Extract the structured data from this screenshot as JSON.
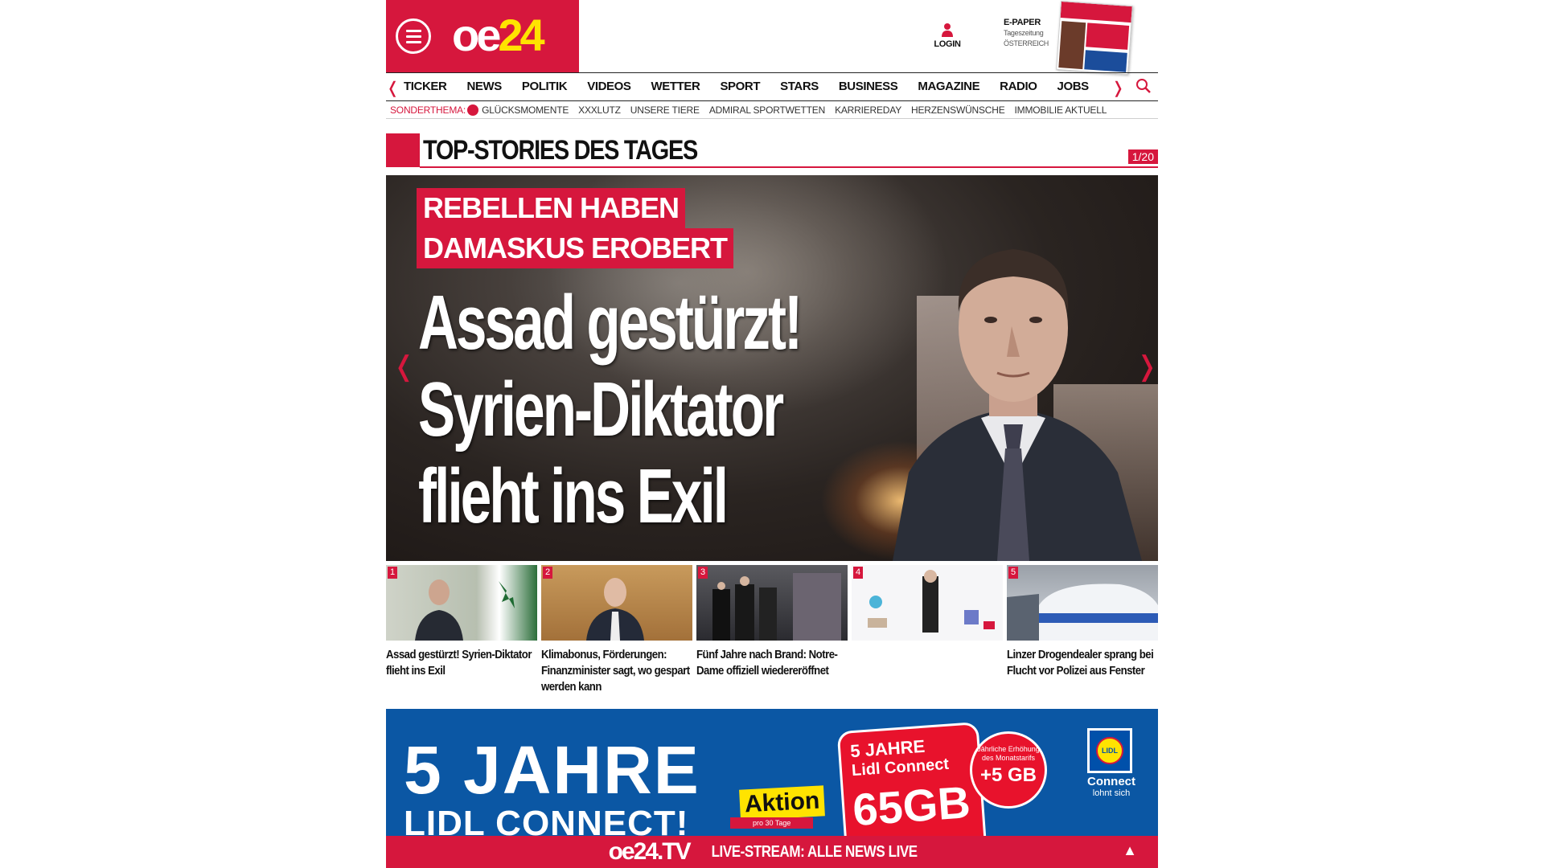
{
  "header": {
    "logo_main": "oe",
    "logo_num": "24",
    "login_label": "LOGIN",
    "epaper_title": "E-PAPER",
    "epaper_sub1": "Tageszeitung",
    "epaper_sub2": "ÖSTERREICH"
  },
  "nav": {
    "items": [
      "TICKER",
      "NEWS",
      "POLITIK",
      "VIDEOS",
      "WETTER",
      "SPORT",
      "STARS",
      "BUSINESS",
      "MAGAZINE",
      "RADIO",
      "JOBS"
    ]
  },
  "sub_nav": {
    "label": "SONDERTHEMA:",
    "items": [
      "GLÜCKSMOMENTE",
      "XXXLUTZ",
      "UNSERE TIERE",
      "ADMIRAL SPORTWETTEN",
      "KARRIEREDAY",
      "HERZENSWÜNSCHE",
      "IMMOBILIE AKTUELL"
    ]
  },
  "section": {
    "title": "TOP-STORIES DES TAGES",
    "counter": "1/20"
  },
  "hero": {
    "kicker_line1": "REBELLEN HABEN",
    "kicker_line2": "DAMASKUS EROBERT",
    "headline_line1": "Assad gestürzt!",
    "headline_line2": "Syrien-Diktator",
    "headline_line3": "flieht ins Exil"
  },
  "stories": [
    {
      "num": "1",
      "caption": "Assad gestürzt! Syrien-Diktator flieht ins Exil"
    },
    {
      "num": "2",
      "caption": "Klimabonus, Förderungen: Finanzminister sagt, wo gespart werden kann"
    },
    {
      "num": "3",
      "caption": "Fünf Jahre nach Brand: Notre-Dame offiziell wiedereröffnet"
    },
    {
      "num": "4",
      "caption": ""
    },
    {
      "num": "5",
      "caption": "Linzer Drogendealer sprang bei Flucht vor Polizei aus Fenster"
    }
  ],
  "ad": {
    "big": "5 JAHRE",
    "big2": "LIDL CONNECT!",
    "aktion": "Aktion",
    "pro": "pro 30 Tage",
    "card_line1": "5 JAHRE",
    "card_line2": "Lidl Connect",
    "card_gb": "65GB",
    "badge_text": "Jährliche Erhöhung des Monatstarifs",
    "badge_gb": "+5 GB",
    "lidl_logo": "LIDL",
    "connect": "Connect",
    "connect_sub": "lohnt sich"
  },
  "livebar": {
    "logo": "oe24.TV",
    "text": "LIVE-STREAM: ALLE NEWS LIVE"
  },
  "colors": {
    "brand_red": "#d6173d",
    "brand_yellow": "#ffe300",
    "ad_blue": "#0b57a4"
  }
}
